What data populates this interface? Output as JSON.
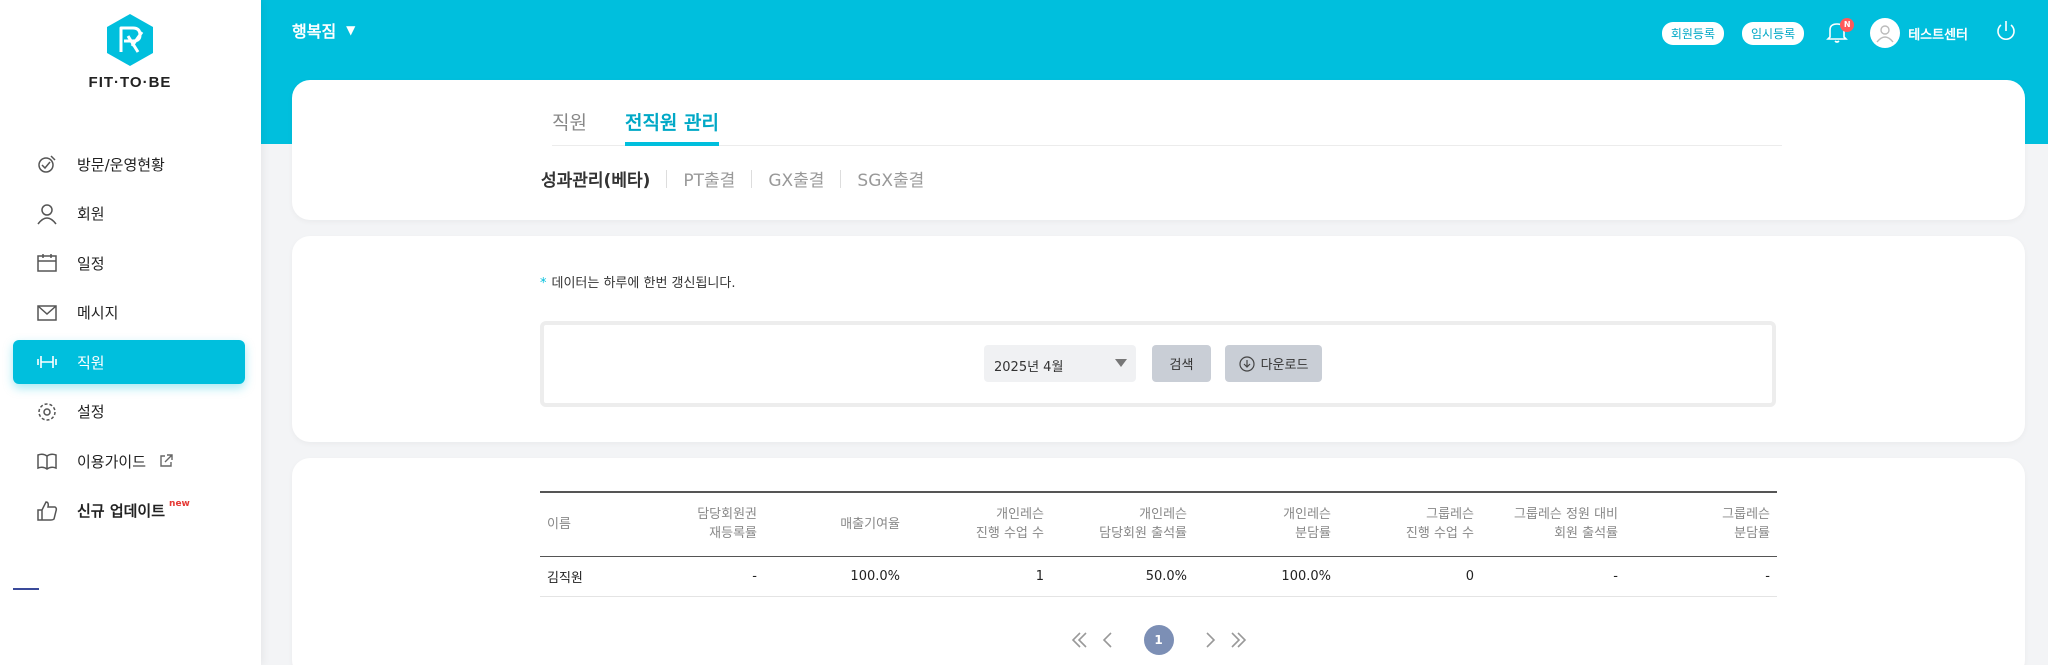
{
  "logo": {
    "text": "FIT·TO·BE"
  },
  "sidebar": {
    "items": [
      {
        "label": "방문/운영현황",
        "icon": "visit-status-icon"
      },
      {
        "label": "회원",
        "icon": "member-icon"
      },
      {
        "label": "일정",
        "icon": "calendar-icon"
      },
      {
        "label": "메시지",
        "icon": "message-icon"
      },
      {
        "label": "직원",
        "icon": "dumbbell-icon",
        "active": true
      },
      {
        "label": "설정",
        "icon": "gear-icon"
      },
      {
        "label": "이용가이드",
        "icon": "book-icon"
      },
      {
        "label": "신규 업데이트",
        "icon": "thumbs-up-icon",
        "tag": "new"
      }
    ]
  },
  "header": {
    "branch": "행복짐",
    "register_member": "회원등록",
    "temp_register": "임시등록",
    "notification_badge": "N",
    "user_name": "테스트센터"
  },
  "tabs": [
    {
      "label": "직원"
    },
    {
      "label": "전직원 관리",
      "active": true
    }
  ],
  "subtabs": [
    {
      "label": "성과관리(베타)",
      "active": true
    },
    {
      "label": "PT출결"
    },
    {
      "label": "GX출결"
    },
    {
      "label": "SGX출결"
    }
  ],
  "notice": "데이터는 하루에 한번 갱신됩니다.",
  "filter": {
    "month": "2025년 4월",
    "search_label": "검색",
    "download_label": "다운로드"
  },
  "table": {
    "headers": [
      "이름",
      "담당회원권\n재등록률",
      "매출기여율",
      "개인레슨\n진행 수업 수",
      "개인레슨\n담당회원 출석률",
      "개인레슨\n분담률",
      "그룹레슨\n진행 수업 수",
      "그룹레슨 정원 대비\n회원 출석률",
      "그룹레슨\n분담률"
    ],
    "rows": [
      [
        "김직원",
        "-",
        "100.0%",
        "1",
        "50.0%",
        "100.0%",
        "0",
        "-",
        "-"
      ]
    ]
  },
  "pagination": {
    "current": "1"
  },
  "colors": {
    "accent": "#00bfdd",
    "accent_text": "#00a8c6",
    "page_num": "#7c8fb5",
    "badge": "#ff5a5a"
  }
}
